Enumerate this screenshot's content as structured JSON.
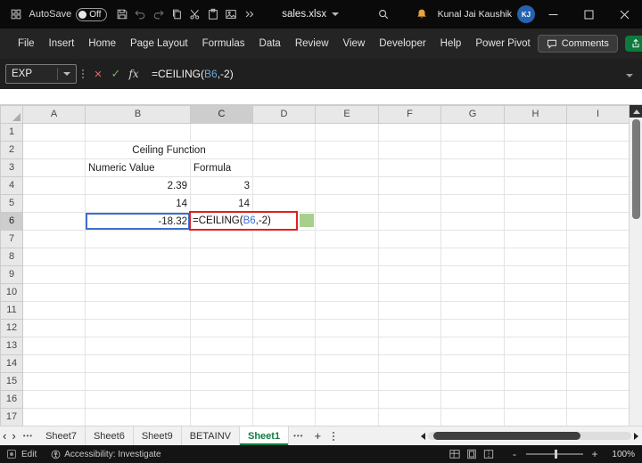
{
  "title_bar": {
    "autosave_label": "AutoSave",
    "autosave_state": "Off",
    "filename": "sales.xlsx",
    "user_name": "Kunal Jai Kaushik",
    "user_initials": "KJ"
  },
  "menu": {
    "items": [
      "File",
      "Insert",
      "Home",
      "Page Layout",
      "Formulas",
      "Data",
      "Review",
      "View",
      "Developer",
      "Help",
      "Power Pivot"
    ],
    "comments_label": "Comments"
  },
  "formula_bar": {
    "name_box": "EXP",
    "formula_prefix": "=CEILING(",
    "formula_ref": "B6",
    "formula_suffix": ",-2)"
  },
  "grid": {
    "columns": [
      "A",
      "B",
      "C",
      "D",
      "E",
      "F",
      "G",
      "H",
      "I"
    ],
    "row_numbers": [
      "1",
      "2",
      "3",
      "4",
      "5",
      "6",
      "7",
      "8",
      "9",
      "10",
      "11",
      "12",
      "13",
      "14",
      "15",
      "16",
      "17"
    ],
    "selected_column": "C",
    "selected_row": "6",
    "cells": [
      {
        "ref": "B2",
        "text": "Ceiling Function",
        "type": "title-cell",
        "colspan": 2
      },
      {
        "ref": "B3",
        "text": "Numeric Value",
        "type": "header-cell"
      },
      {
        "ref": "C3",
        "text": "Formula",
        "type": "header-cell"
      },
      {
        "ref": "B4",
        "text": "2.39",
        "type": "value-cell"
      },
      {
        "ref": "C4",
        "text": "3",
        "type": "value-cell"
      },
      {
        "ref": "B5",
        "text": "14",
        "type": "value-cell"
      },
      {
        "ref": "C5",
        "text": "14",
        "type": "value-cell"
      },
      {
        "ref": "B6",
        "text": "-18.32",
        "type": "ref-cell"
      },
      {
        "ref": "C6",
        "text": "",
        "type": "edit-under-cell"
      },
      {
        "ref": "B7",
        "text": "",
        "type": "green-cell"
      },
      {
        "ref": "C7",
        "text": "",
        "type": "green-cell"
      }
    ],
    "edit_overlay": {
      "prefix": "=CEILING(",
      "ref": "B6",
      "suffix": ",-2)"
    }
  },
  "sheet_tabs": {
    "tabs": [
      {
        "label": "Sheet7",
        "active": false
      },
      {
        "label": "Sheet6",
        "active": false
      },
      {
        "label": "Sheet9",
        "active": false
      },
      {
        "label": "BETAINV",
        "active": false
      },
      {
        "label": "Sheet1",
        "active": true
      }
    ]
  },
  "status_bar": {
    "mode": "Edit",
    "accessibility": "Accessibility: Investigate",
    "zoom": "100%"
  },
  "colors": {
    "accent_green": "#107C41",
    "table_title_orange": "#F6A243",
    "table_header_blue": "#4E81BD",
    "table_value_green": "#A8D08D",
    "reference_blue": "#3E6FD0",
    "edit_border_red": "#E02020",
    "avatar_blue": "#2563B0"
  }
}
